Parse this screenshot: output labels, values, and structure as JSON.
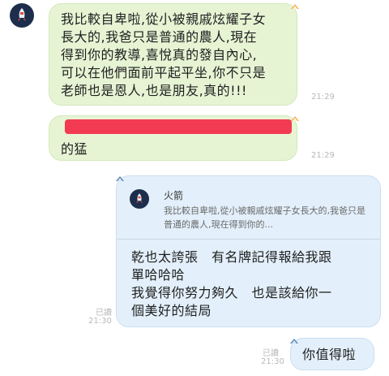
{
  "messages": [
    {
      "sender": "left",
      "text": "我比較自卑啦,從小被親戚炫耀子女\n長大的,我爸只是普通的農人,現在\n得到你的教導,喜悅真的發自內心,\n可以在他們面前平起平坐,你不只是\n老師也是恩人,也是朋友,真的!!!",
      "time": "21:29"
    },
    {
      "sender": "left",
      "text_line2": "的猛",
      "redacted": true,
      "time": "21:29"
    },
    {
      "sender": "right",
      "quote_name": "火箭",
      "quote_text": "我比較自卑啦,從小被親戚炫耀子女長大的,我爸只是普通的農人,現在得到你的...",
      "text": "乾也太誇張　有名牌記得報給我跟\n單哈哈哈\n我覺得你努力夠久　也是該給你一\n個美好的結局",
      "read": "已讀",
      "time": "21:30"
    },
    {
      "sender": "right",
      "text": "你值得啦",
      "read": "已讀",
      "time": "21:30"
    }
  ],
  "colors": {
    "left_bubble": "#e6f4d4",
    "right_bubble": "#e3f0fb",
    "redaction": "#f23b52"
  },
  "icons": {
    "avatar": "rocket-icon",
    "corner": "pin-icon"
  }
}
